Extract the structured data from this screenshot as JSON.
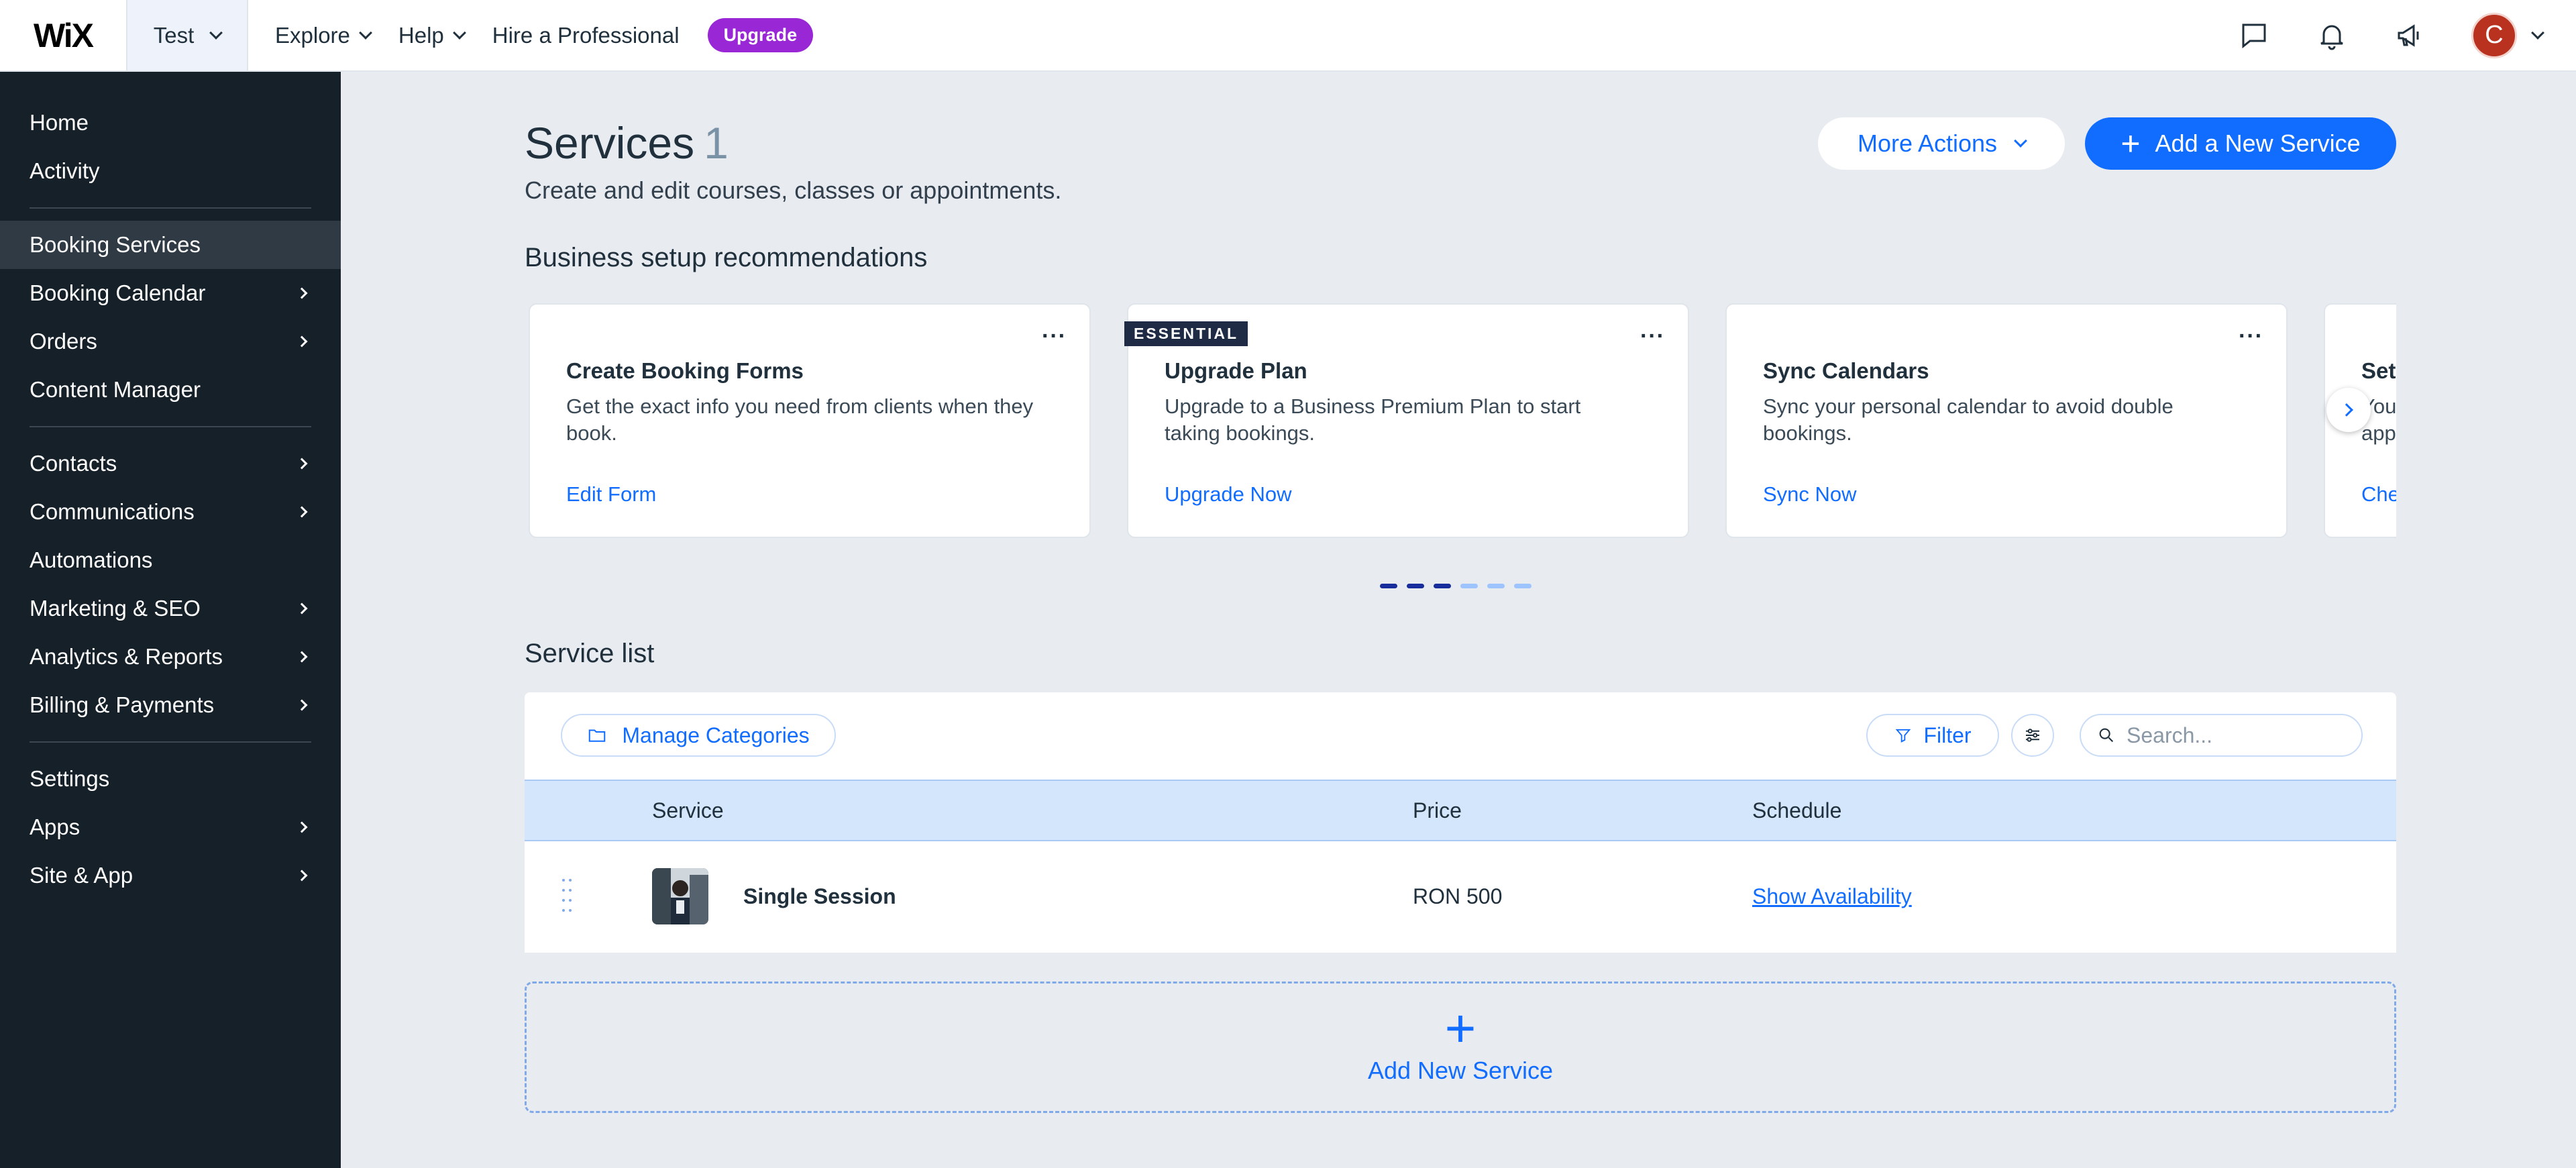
{
  "topbar": {
    "logo": "WiX",
    "site_name": "Test",
    "nav": [
      "Explore",
      "Help",
      "Hire a Professional"
    ],
    "upgrade_label": "Upgrade",
    "avatar_initial": "C"
  },
  "sidebar": {
    "group1": [
      {
        "label": "Home",
        "has_arrow": false
      },
      {
        "label": "Activity",
        "has_arrow": false
      }
    ],
    "group2": [
      {
        "label": "Booking Services",
        "has_arrow": false,
        "active": true
      },
      {
        "label": "Booking Calendar",
        "has_arrow": true
      },
      {
        "label": "Orders",
        "has_arrow": true
      },
      {
        "label": "Content Manager",
        "has_arrow": false
      }
    ],
    "group3": [
      {
        "label": "Contacts",
        "has_arrow": true
      },
      {
        "label": "Communications",
        "has_arrow": true
      },
      {
        "label": "Automations",
        "has_arrow": false
      },
      {
        "label": "Marketing & SEO",
        "has_arrow": true
      },
      {
        "label": "Analytics & Reports",
        "has_arrow": true
      },
      {
        "label": "Billing & Payments",
        "has_arrow": true
      }
    ],
    "group4": [
      {
        "label": "Settings",
        "has_arrow": false
      },
      {
        "label": "Apps",
        "has_arrow": true
      },
      {
        "label": "Site & App",
        "has_arrow": true
      }
    ]
  },
  "header": {
    "title": "Services",
    "count": "1",
    "subtitle": "Create and edit courses, classes or appointments.",
    "more_actions": "More Actions",
    "add_service": "Add a New Service"
  },
  "recommendations": {
    "title": "Business setup recommendations",
    "cards": [
      {
        "title": "Create Booking Forms",
        "desc": "Get the exact info you need from clients when they book.",
        "link": "Edit Form",
        "badge": ""
      },
      {
        "title": "Upgrade Plan",
        "desc": "Upgrade to a Business Premium Plan to start taking bookings.",
        "link": "Upgrade Now",
        "badge": "ESSENTIAL"
      },
      {
        "title": "Sync Calendars",
        "desc": "Sync your personal calendar to avoid double bookings.",
        "link": "Sync Now",
        "badge": ""
      },
      {
        "title": "Set",
        "desc": "You app",
        "link": "Che",
        "badge": ""
      }
    ],
    "pager": [
      "dark",
      "dark",
      "dark",
      "light",
      "light",
      "light"
    ],
    "more_glyph": "···"
  },
  "service_list": {
    "title": "Service list",
    "manage_categories": "Manage Categories",
    "filter": "Filter",
    "search_placeholder": "Search...",
    "columns": [
      "Service",
      "Price",
      "Schedule"
    ],
    "rows": [
      {
        "name": "Single Session",
        "price": "RON 500",
        "schedule": "Show Availability"
      }
    ],
    "add_new": "Add New Service"
  },
  "colors": {
    "accent": "#116dff",
    "upgrade": "#9a27d5",
    "sidebar_bg": "#162029",
    "avatar": "#b8321f"
  }
}
